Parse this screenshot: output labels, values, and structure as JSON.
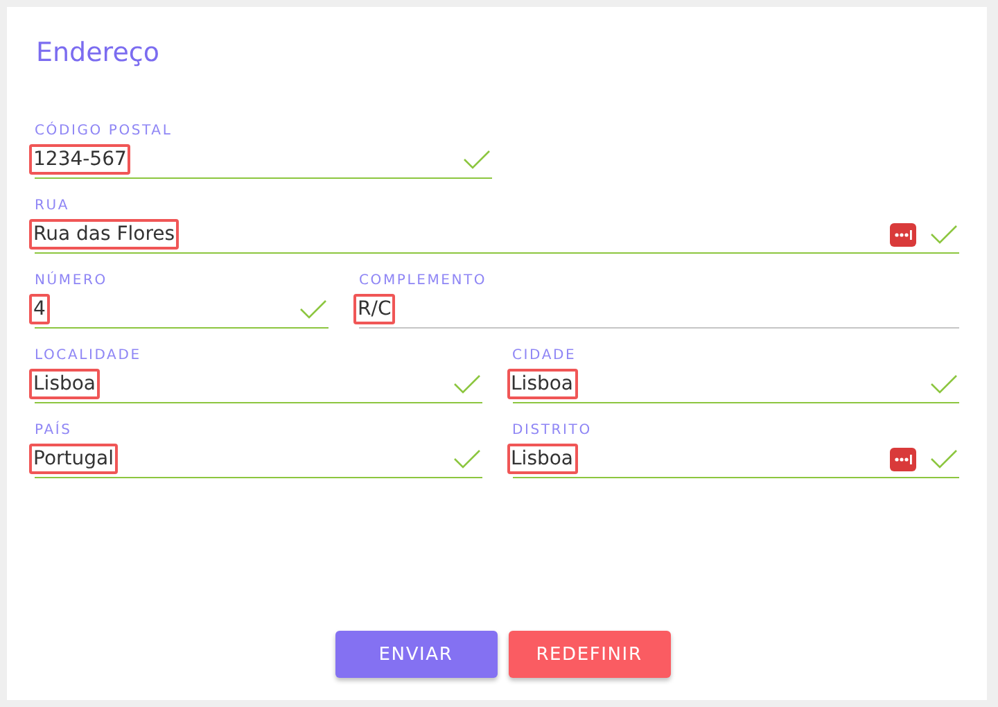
{
  "title": "Endereço",
  "rows": [
    {
      "fields": [
        {
          "label": "CÓDIGO POSTAL",
          "value": "1234-567",
          "valid": true,
          "highlighted": true
        }
      ]
    },
    {
      "fields": [
        {
          "label": "RUA",
          "value": "Rua das Flores",
          "valid": true,
          "highlighted": true,
          "password_manager": true
        }
      ]
    },
    {
      "fields": [
        {
          "label": "NÚMERO",
          "value": "4",
          "valid": true,
          "highlighted": true
        },
        {
          "label": "COMPLEMENTO",
          "value": "R/C",
          "valid": false,
          "highlighted": true
        }
      ]
    },
    {
      "fields": [
        {
          "label": "LOCALIDADE",
          "value": "Lisboa",
          "valid": true,
          "highlighted": true
        },
        {
          "label": "CIDADE",
          "value": "Lisboa",
          "valid": true,
          "highlighted": true
        }
      ]
    },
    {
      "fields": [
        {
          "label": "PAÍS",
          "value": "Portugal",
          "valid": true,
          "highlighted": true
        },
        {
          "label": "DISTRITO",
          "value": "Lisboa",
          "valid": true,
          "highlighted": true,
          "password_manager": true
        }
      ]
    }
  ],
  "buttons": [
    {
      "label": "ENVIAR",
      "kind": "primary"
    },
    {
      "label": "REDEFINIR",
      "kind": "danger"
    }
  ]
}
